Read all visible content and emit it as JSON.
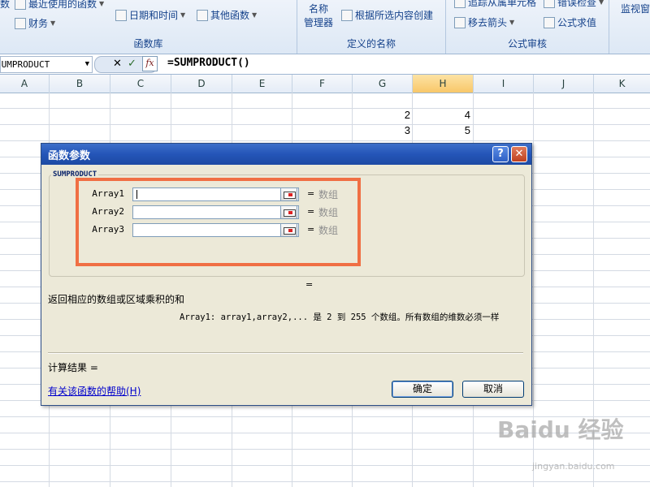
{
  "ribbon": {
    "groups": [
      {
        "label": "函数库",
        "buttons": [
          "数",
          "最近使用的函数",
          "财务",
          "日期和时间",
          "其他函数"
        ]
      },
      {
        "label": "定义的名称",
        "buttons": [
          "名称",
          "管理器",
          "根据所选内容创建"
        ]
      },
      {
        "label": "公式审核",
        "buttons": [
          "追踪从属单元格",
          "错误检查",
          "移去箭头",
          "公式求值"
        ]
      }
    ],
    "watch_label": "监视窗"
  },
  "formula_bar": {
    "name_box": "SUMPRODUCT",
    "cancel_symbol": "✕",
    "enter_symbol": "✓",
    "fx_label": "fx",
    "formula": "=SUMPRODUCT()"
  },
  "columns": [
    "A",
    "B",
    "C",
    "D",
    "E",
    "F",
    "G",
    "H",
    "I",
    "J",
    "K"
  ],
  "selected_column": "H",
  "cells": [
    {
      "col": "G",
      "row": 1,
      "value": "2"
    },
    {
      "col": "H",
      "row": 1,
      "value": "4"
    },
    {
      "col": "G",
      "row": 2,
      "value": "3"
    },
    {
      "col": "H",
      "row": 2,
      "value": "5"
    }
  ],
  "dialog": {
    "title": "函数参数",
    "help_symbol": "?",
    "close_symbol": "✕",
    "function_name": "SUMPRODUCT",
    "args": [
      {
        "label": "Array1",
        "eq": "=",
        "value": "数组"
      },
      {
        "label": "Array2",
        "eq": "=",
        "value": "数组"
      },
      {
        "label": "Array3",
        "eq": "=",
        "value": "数组"
      }
    ],
    "result_eq": "=",
    "description": "返回相应的数组或区域乘积的和",
    "arg_description": "Array1:  array1,array2,... 是 2 到 255 个数组。所有数组的维数必须一样",
    "calc_result": "计算结果 =",
    "help_link": "有关该函数的帮助(H)",
    "ok_label": "确定",
    "cancel_label": "取消"
  },
  "watermark": {
    "logo_text": "Baidu 经验",
    "url": "jingyan.baidu.com"
  },
  "colors": {
    "highlight": "#f06f44",
    "titlebar": "#2455b8",
    "selected_column": "#f8c769"
  }
}
